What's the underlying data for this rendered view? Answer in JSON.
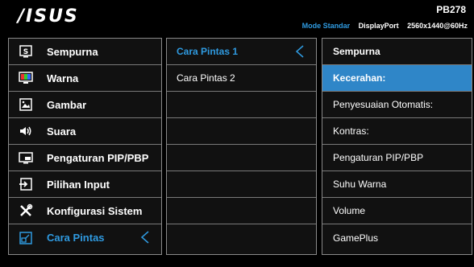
{
  "header": {
    "logo": "/ISUS",
    "model": "PB278",
    "mode": "Mode Standar",
    "port": "DisplayPort",
    "resolution": "2560x1440@60Hz"
  },
  "main_menu": [
    {
      "label": "Sempurna",
      "icon": "splendid-icon"
    },
    {
      "label": "Warna",
      "icon": "color-icon"
    },
    {
      "label": "Gambar",
      "icon": "image-icon"
    },
    {
      "label": "Suara",
      "icon": "speaker-icon"
    },
    {
      "label": "Pengaturan PIP/PBP",
      "icon": "pip-icon"
    },
    {
      "label": "Pilihan Input",
      "icon": "input-icon"
    },
    {
      "label": "Konfigurasi Sistem",
      "icon": "tools-icon"
    },
    {
      "label": "Cara Pintas",
      "icon": "shortcut-icon",
      "selected": true
    }
  ],
  "submenu": [
    {
      "label": "Cara Pintas 1",
      "selected": true
    },
    {
      "label": "Cara Pintas 2"
    }
  ],
  "options": {
    "title": "Sempurna",
    "items": [
      {
        "label": "Kecerahan:",
        "highlighted": true
      },
      {
        "label": "Penyesuaian Otomatis:"
      },
      {
        "label": "Kontras:"
      },
      {
        "label": "Pengaturan PIP/PBP"
      },
      {
        "label": "Suhu Warna"
      },
      {
        "label": "Volume"
      },
      {
        "label": "GamePlus"
      }
    ]
  },
  "colors": {
    "accent": "#2f9ae0",
    "highlight": "#2f86c8",
    "border": "#8a8a8a",
    "panel_bg": "#111111"
  }
}
